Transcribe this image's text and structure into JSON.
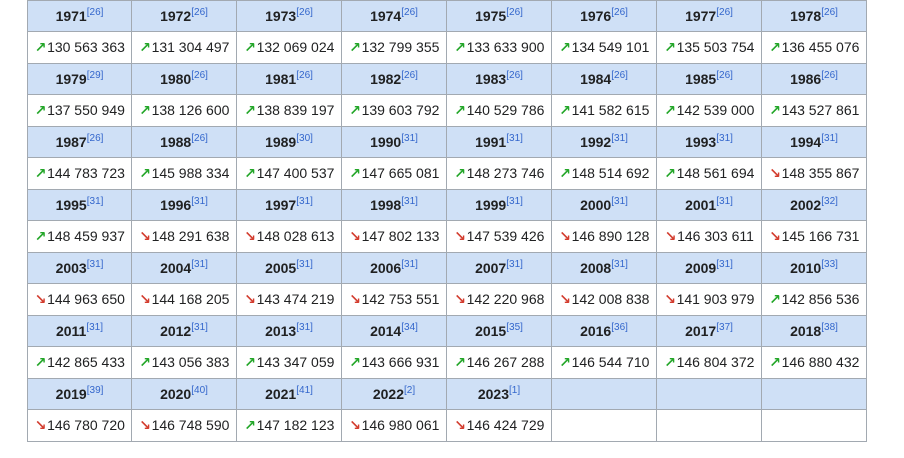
{
  "colors": {
    "header_bg": "#cfe0f6",
    "up": "#23a628",
    "down": "#d33c2e",
    "ref": "#3366cc"
  },
  "icons": {
    "up": "↗",
    "down": "↘"
  },
  "rows": [
    [
      {
        "year": "1971",
        "ref": "[26]",
        "value": "130 563 363",
        "trend": "up"
      },
      {
        "year": "1972",
        "ref": "[26]",
        "value": "131 304 497",
        "trend": "up"
      },
      {
        "year": "1973",
        "ref": "[26]",
        "value": "132 069 024",
        "trend": "up"
      },
      {
        "year": "1974",
        "ref": "[26]",
        "value": "132 799 355",
        "trend": "up"
      },
      {
        "year": "1975",
        "ref": "[26]",
        "value": "133 633 900",
        "trend": "up"
      },
      {
        "year": "1976",
        "ref": "[26]",
        "value": "134 549 101",
        "trend": "up"
      },
      {
        "year": "1977",
        "ref": "[26]",
        "value": "135 503 754",
        "trend": "up"
      },
      {
        "year": "1978",
        "ref": "[26]",
        "value": "136 455 076",
        "trend": "up"
      }
    ],
    [
      {
        "year": "1979",
        "ref": "[29]",
        "value": "137 550 949",
        "trend": "up"
      },
      {
        "year": "1980",
        "ref": "[26]",
        "value": "138 126 600",
        "trend": "up"
      },
      {
        "year": "1981",
        "ref": "[26]",
        "value": "138 839 197",
        "trend": "up"
      },
      {
        "year": "1982",
        "ref": "[26]",
        "value": "139 603 792",
        "trend": "up"
      },
      {
        "year": "1983",
        "ref": "[26]",
        "value": "140 529 786",
        "trend": "up"
      },
      {
        "year": "1984",
        "ref": "[26]",
        "value": "141 582 615",
        "trend": "up"
      },
      {
        "year": "1985",
        "ref": "[26]",
        "value": "142 539 000",
        "trend": "up"
      },
      {
        "year": "1986",
        "ref": "[26]",
        "value": "143 527 861",
        "trend": "up"
      }
    ],
    [
      {
        "year": "1987",
        "ref": "[26]",
        "value": "144 783 723",
        "trend": "up"
      },
      {
        "year": "1988",
        "ref": "[26]",
        "value": "145 988 334",
        "trend": "up"
      },
      {
        "year": "1989",
        "ref": "[30]",
        "value": "147 400 537",
        "trend": "up"
      },
      {
        "year": "1990",
        "ref": "[31]",
        "value": "147 665 081",
        "trend": "up"
      },
      {
        "year": "1991",
        "ref": "[31]",
        "value": "148 273 746",
        "trend": "up"
      },
      {
        "year": "1992",
        "ref": "[31]",
        "value": "148 514 692",
        "trend": "up"
      },
      {
        "year": "1993",
        "ref": "[31]",
        "value": "148 561 694",
        "trend": "up"
      },
      {
        "year": "1994",
        "ref": "[31]",
        "value": "148 355 867",
        "trend": "down"
      }
    ],
    [
      {
        "year": "1995",
        "ref": "[31]",
        "value": "148 459 937",
        "trend": "up"
      },
      {
        "year": "1996",
        "ref": "[31]",
        "value": "148 291 638",
        "trend": "down"
      },
      {
        "year": "1997",
        "ref": "[31]",
        "value": "148 028 613",
        "trend": "down"
      },
      {
        "year": "1998",
        "ref": "[31]",
        "value": "147 802 133",
        "trend": "down"
      },
      {
        "year": "1999",
        "ref": "[31]",
        "value": "147 539 426",
        "trend": "down"
      },
      {
        "year": "2000",
        "ref": "[31]",
        "value": "146 890 128",
        "trend": "down"
      },
      {
        "year": "2001",
        "ref": "[31]",
        "value": "146 303 611",
        "trend": "down"
      },
      {
        "year": "2002",
        "ref": "[32]",
        "value": "145 166 731",
        "trend": "down"
      }
    ],
    [
      {
        "year": "2003",
        "ref": "[31]",
        "value": "144 963 650",
        "trend": "down"
      },
      {
        "year": "2004",
        "ref": "[31]",
        "value": "144 168 205",
        "trend": "down"
      },
      {
        "year": "2005",
        "ref": "[31]",
        "value": "143 474 219",
        "trend": "down"
      },
      {
        "year": "2006",
        "ref": "[31]",
        "value": "142 753 551",
        "trend": "down"
      },
      {
        "year": "2007",
        "ref": "[31]",
        "value": "142 220 968",
        "trend": "down"
      },
      {
        "year": "2008",
        "ref": "[31]",
        "value": "142 008 838",
        "trend": "down"
      },
      {
        "year": "2009",
        "ref": "[31]",
        "value": "141 903 979",
        "trend": "down"
      },
      {
        "year": "2010",
        "ref": "[33]",
        "value": "142 856 536",
        "trend": "up"
      }
    ],
    [
      {
        "year": "2011",
        "ref": "[31]",
        "value": "142 865 433",
        "trend": "up"
      },
      {
        "year": "2012",
        "ref": "[31]",
        "value": "143 056 383",
        "trend": "up"
      },
      {
        "year": "2013",
        "ref": "[31]",
        "value": "143 347 059",
        "trend": "up"
      },
      {
        "year": "2014",
        "ref": "[34]",
        "value": "143 666 931",
        "trend": "up"
      },
      {
        "year": "2015",
        "ref": "[35]",
        "value": "146 267 288",
        "trend": "up"
      },
      {
        "year": "2016",
        "ref": "[36]",
        "value": "146 544 710",
        "trend": "up"
      },
      {
        "year": "2017",
        "ref": "[37]",
        "value": "146 804 372",
        "trend": "up"
      },
      {
        "year": "2018",
        "ref": "[38]",
        "value": "146 880 432",
        "trend": "up"
      }
    ],
    [
      {
        "year": "2019",
        "ref": "[39]",
        "value": "146 780 720",
        "trend": "down"
      },
      {
        "year": "2020",
        "ref": "[40]",
        "value": "146 748 590",
        "trend": "down"
      },
      {
        "year": "2021",
        "ref": "[41]",
        "value": "147 182 123",
        "trend": "up"
      },
      {
        "year": "2022",
        "ref": "[2]",
        "value": "146 980 061",
        "trend": "down"
      },
      {
        "year": "2023",
        "ref": "[1]",
        "value": "146 424 729",
        "trend": "down"
      },
      {
        "year": "",
        "ref": "",
        "value": "",
        "trend": ""
      },
      {
        "year": "",
        "ref": "",
        "value": "",
        "trend": ""
      },
      {
        "year": "",
        "ref": "",
        "value": "",
        "trend": ""
      }
    ]
  ]
}
